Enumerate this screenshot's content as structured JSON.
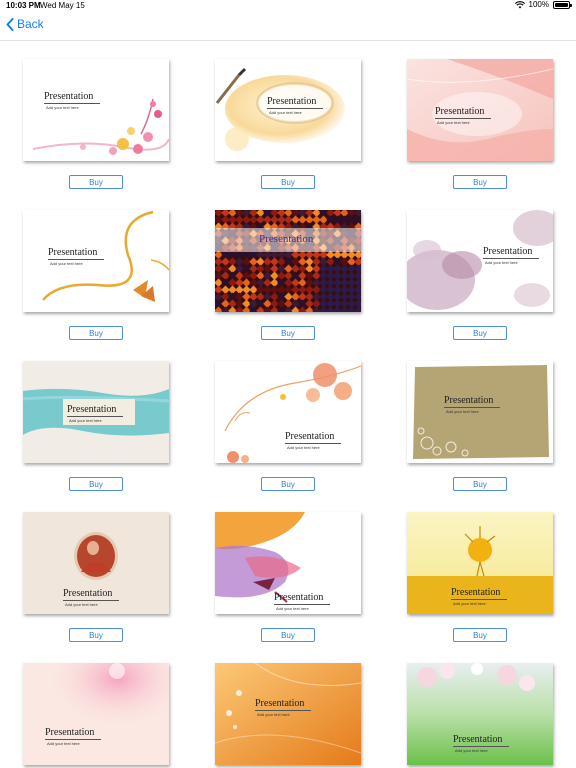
{
  "status_bar": {
    "time": "10:03 PM",
    "date": "Wed May 15",
    "battery": "100%",
    "battery_level": 1.0
  },
  "nav": {
    "back_label": "Back"
  },
  "template_title": "Presentation",
  "template_subtitle": "Add your text here",
  "buy_label": "Buy",
  "accent_color": "#1a7ef2",
  "templates": [
    {
      "theme": "floral-pink-swirls"
    },
    {
      "theme": "watercolor-brush-ring"
    },
    {
      "theme": "pink-waves"
    },
    {
      "theme": "gold-swirl-leaf"
    },
    {
      "theme": "red-mosaic"
    },
    {
      "theme": "purple-watercolor"
    },
    {
      "theme": "teal-brush-stroke"
    },
    {
      "theme": "orange-floral-branch"
    },
    {
      "theme": "olive-grunge-frame"
    },
    {
      "theme": "vintage-oval-portrait"
    },
    {
      "theme": "sunset-watercolor"
    },
    {
      "theme": "yellow-ballerina"
    },
    {
      "theme": "pink-blossom-glow"
    },
    {
      "theme": "orange-gradient-flowers"
    },
    {
      "theme": "cherry-blossom-green"
    }
  ]
}
